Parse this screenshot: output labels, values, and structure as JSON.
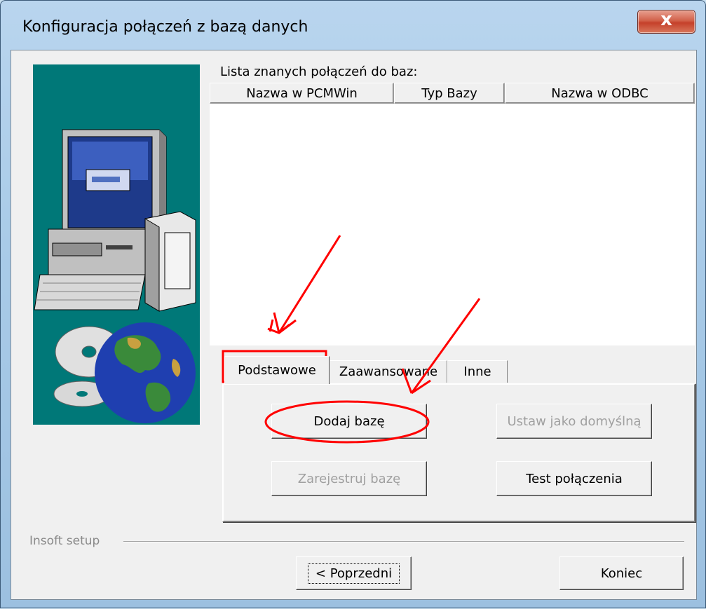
{
  "window": {
    "title": "Konfiguracja połączeń z bazą danych",
    "close_symbol": "x"
  },
  "list": {
    "caption": "Lista znanych połączeń do baz:",
    "columns": [
      "Nazwa w PCMWin",
      "Typ Bazy",
      "Nazwa w ODBC"
    ],
    "rows": []
  },
  "tabs": [
    {
      "label": "Podstawowe",
      "active": true
    },
    {
      "label": "Zaawansowane",
      "active": false
    },
    {
      "label": "Inne",
      "active": false
    }
  ],
  "buttons": {
    "add_db": "Dodaj bazę",
    "set_default": "Ustaw jako domyślną",
    "register_db": "Zarejestruj bazę",
    "test_connection": "Test połączenia",
    "previous": "< Poprzedni",
    "finish": "Koniec"
  },
  "footer": {
    "group_label": "Insoft setup"
  },
  "colors": {
    "annotation": "#ff0000",
    "illustration_bg": "#007878"
  }
}
